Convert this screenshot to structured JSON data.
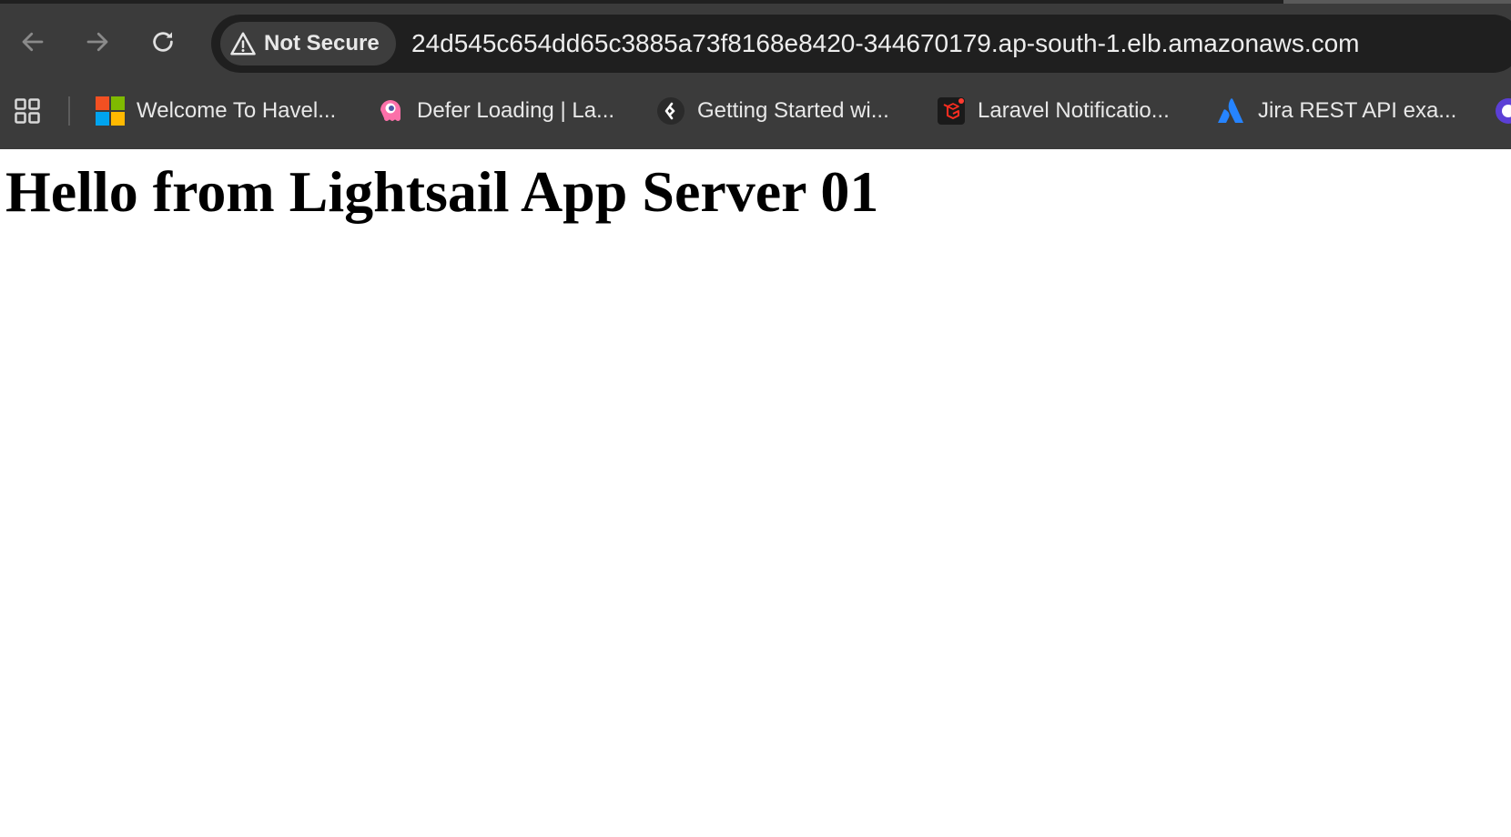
{
  "browser": {
    "security_label": "Not Secure",
    "url": "24d545c654dd65c3885a73f8168e8420-344670179.ap-south-1.elb.amazonaws.com",
    "nav": {
      "back_icon": "arrow-left-icon",
      "forward_icon": "arrow-right-icon",
      "reload_icon": "reload-icon"
    },
    "apps_icon": "apps-grid-icon",
    "bookmarks": [
      {
        "label": "Welcome To Havel...",
        "icon": "microsoft-logo-icon"
      },
      {
        "label": "Defer Loading | La...",
        "icon": "livewire-logo-icon"
      },
      {
        "label": "Getting Started wi...",
        "icon": "diamond-arrow-logo-icon"
      },
      {
        "label": "Laravel Notificatio...",
        "icon": "laravel-logo-icon"
      },
      {
        "label": "Jira REST API exa...",
        "icon": "atlassian-logo-icon"
      },
      {
        "label": "",
        "icon": "purple-circle-logo-icon"
      }
    ]
  },
  "page": {
    "heading": "Hello from Lightsail App Server 01"
  },
  "colors": {
    "chrome_bg": "#3b3b3b",
    "omnibox_bg": "#1f1f1f",
    "chip_bg": "#3d3d3d",
    "text_light": "#e8e8e8",
    "page_bg": "#ffffff"
  }
}
